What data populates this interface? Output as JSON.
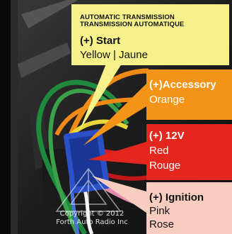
{
  "header": {
    "line1": "AUTOMATIC TRANSMISSION",
    "line2": "TRANSMISSION AUTOMATIQUE"
  },
  "callouts": {
    "start": {
      "title": "(+) Start",
      "subtitle": "Yellow | Jaune",
      "color": "#f7f18c"
    },
    "accessory": {
      "title": "(+)Accessory",
      "line1": "Orange",
      "color": "#f39419"
    },
    "power": {
      "title": "(+) 12V",
      "line1": "Red",
      "line2": "Rouge",
      "color": "#e3271f"
    },
    "ignition": {
      "title": "(+) Ignition",
      "line1": "Pink",
      "line2": "Rose",
      "color": "#f8cdc0"
    }
  },
  "watermark": {
    "line1": "Copyright © 2012",
    "line2": "Forth Auto Radio Inc"
  }
}
